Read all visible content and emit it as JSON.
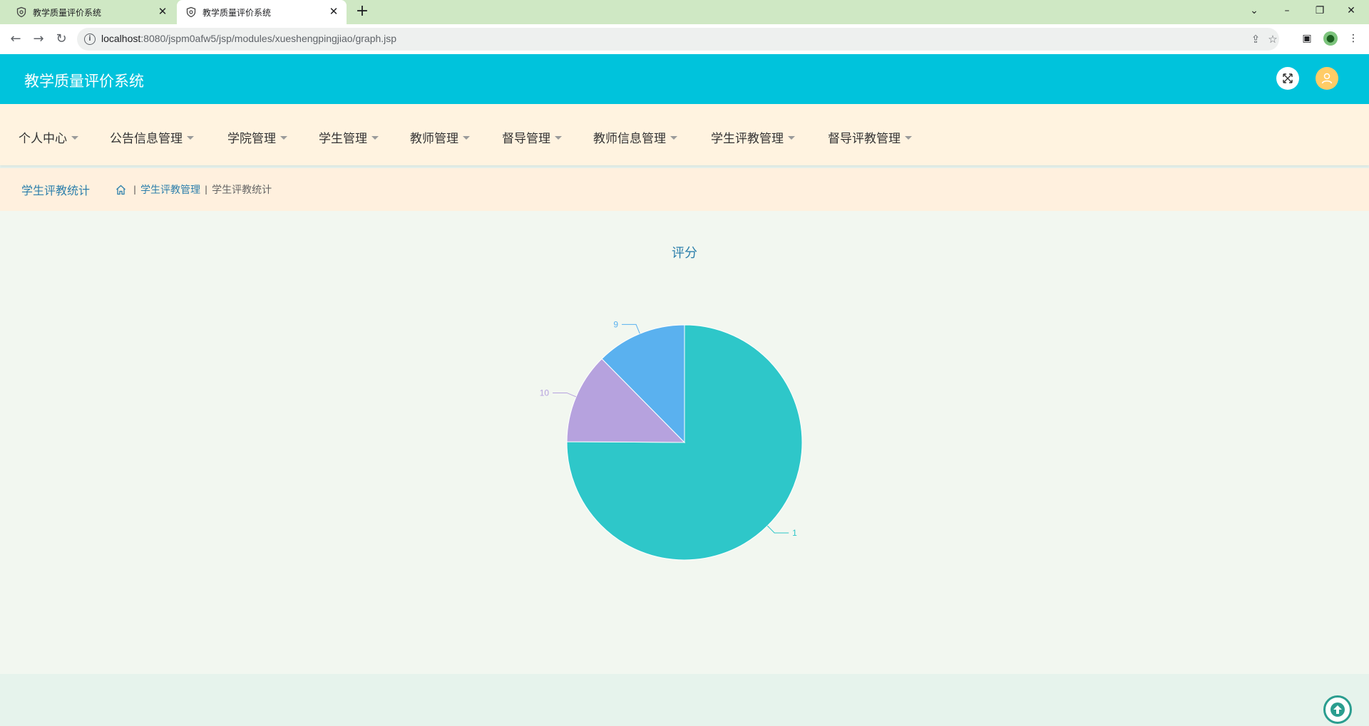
{
  "browser": {
    "tabs": [
      {
        "title": "教学质量评价系统"
      },
      {
        "title": "教学质量评价系统"
      }
    ],
    "url_host": "localhost",
    "url_path": ":8080/jspm0afw5/jsp/modules/xueshengpingjiao/graph.jsp"
  },
  "app": {
    "title": "教学质量评价系统"
  },
  "menu": [
    {
      "label": "个人中心"
    },
    {
      "label": "公告信息管理"
    },
    {
      "label": "学院管理"
    },
    {
      "label": "学生管理"
    },
    {
      "label": "教师管理"
    },
    {
      "label": "督导管理"
    },
    {
      "label": "教师信息管理"
    },
    {
      "label": "学生评教管理"
    },
    {
      "label": "督导评教管理"
    }
  ],
  "breadcrumb": {
    "page_title": "学生评教统计",
    "items": [
      "学生评教管理",
      "学生评教统计"
    ]
  },
  "chart_data": {
    "type": "pie",
    "title": "评分",
    "slices": [
      {
        "label": "1",
        "value": 75.1,
        "color": "#2ec7c9"
      },
      {
        "label": "10",
        "value": 12.5,
        "color": "#b6a2de"
      },
      {
        "label": "9",
        "value": 12.4,
        "color": "#5ab1ef"
      }
    ],
    "start_angle_deg": 90,
    "direction": "clockwise"
  }
}
